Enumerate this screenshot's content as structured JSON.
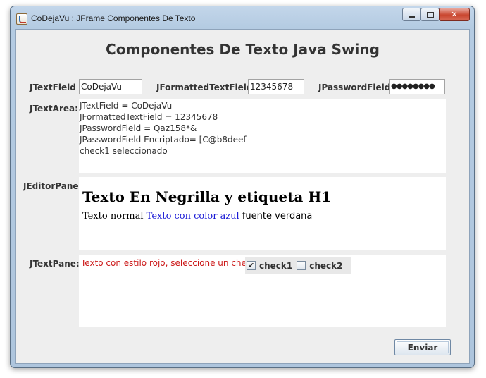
{
  "window": {
    "title": "CoDejaVu : JFrame Componentes De Texto",
    "controls": {
      "minimize": "",
      "maximize": "",
      "close": "✕"
    }
  },
  "heading": "Componentes De Texto Java Swing",
  "text_field": {
    "label": "JTextField :",
    "value": "CoDejaVu"
  },
  "formatted_field": {
    "label": "JFormattedTextField :",
    "value": "12345678"
  },
  "password_field": {
    "label": "JPasswordField :",
    "value": "●●●●●●●●"
  },
  "text_area": {
    "label": "JTextArea:",
    "lines": [
      "JTextField = CoDejaVu",
      "JFormattedTextField = 12345678",
      "JPasswordField = Qaz158*&",
      "JPasswordField Encriptado= [C@b8deef",
      "check1 seleccionado"
    ]
  },
  "editor_pane": {
    "label": "JEditorPane:",
    "h1": "Texto En Negrilla y etiqueta H1",
    "normal_text": "Texto normal ",
    "blue_text": "Texto con color azul",
    "verdana_text": " fuente verdana"
  },
  "text_pane": {
    "label": "JTextPane:",
    "red_text": "Texto con estilo rojo, seleccione un check",
    "check1": {
      "label": "check1",
      "checked": true,
      "mark": "✔"
    },
    "check2": {
      "label": "check2",
      "checked": false,
      "mark": ""
    }
  },
  "send_button": "Enviar",
  "colors": {
    "blue_text": "#1a1ad6",
    "red_text": "#cc1a1a",
    "panel_bg": "#eeeeee"
  }
}
